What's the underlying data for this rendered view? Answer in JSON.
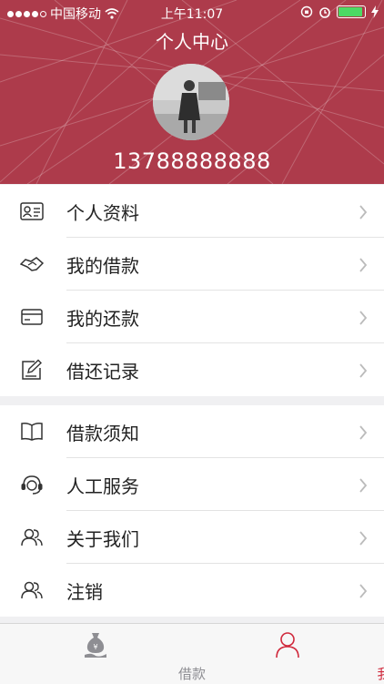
{
  "status_bar": {
    "carrier": "中国移动",
    "time": "上午11:07"
  },
  "header": {
    "title": "个人中心",
    "phone": "13788888888",
    "bg_color": "#ad3b4b"
  },
  "menu_group_1": [
    {
      "label": "个人资料",
      "icon": "id-card-icon"
    },
    {
      "label": "我的借款",
      "icon": "handshake-icon"
    },
    {
      "label": "我的还款",
      "icon": "credit-card-icon"
    },
    {
      "label": "借还记录",
      "icon": "edit-icon"
    }
  ],
  "menu_group_2": [
    {
      "label": "借款须知",
      "icon": "book-icon"
    },
    {
      "label": "人工服务",
      "icon": "headset-icon"
    },
    {
      "label": "关于我们",
      "icon": "users-icon"
    },
    {
      "label": "注销",
      "icon": "users-icon"
    }
  ],
  "tabbar": {
    "tabs": [
      {
        "label": "借款",
        "icon": "money-bag-icon"
      },
      {
        "label": "我",
        "icon": "user-icon"
      }
    ],
    "active_color": "#d0283b",
    "inactive_color": "#8e8e93"
  }
}
